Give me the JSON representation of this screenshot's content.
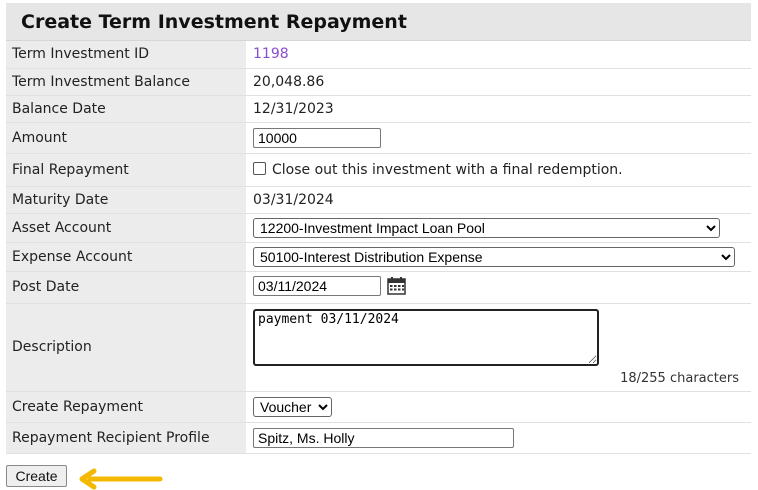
{
  "form": {
    "title": "Create Term Investment Repayment",
    "rows": {
      "term_investment_id": {
        "label": "Term Investment ID",
        "value": "1198"
      },
      "balance": {
        "label": "Term Investment Balance",
        "value": "20,048.86"
      },
      "balance_date": {
        "label": "Balance Date",
        "value": "12/31/2023"
      },
      "amount": {
        "label": "Amount",
        "value": "10000"
      },
      "final_repayment": {
        "label": "Final Repayment",
        "checkbox_label": "Close out this investment with a final redemption.",
        "checked": false
      },
      "maturity_date": {
        "label": "Maturity Date",
        "value": "03/31/2024"
      },
      "asset_account": {
        "label": "Asset Account",
        "selected": "12200-Investment Impact Loan Pool"
      },
      "expense_account": {
        "label": "Expense Account",
        "selected": "50100-Interest Distribution Expense"
      },
      "post_date": {
        "label": "Post Date",
        "value": "03/11/2024"
      },
      "description": {
        "label": "Description",
        "value": "payment 03/11/2024",
        "char_count": "18/255 characters"
      },
      "create_repayment": {
        "label": "Create Repayment",
        "selected": "Voucher"
      },
      "recipient_profile": {
        "label": "Repayment Recipient Profile",
        "value": "Spitz, Ms. Holly"
      }
    },
    "create_button": "Create"
  },
  "colors": {
    "arrow": "#f5b800",
    "link": "#8a4ccf",
    "label_bg": "#ececec",
    "header_bg": "#e6e6e6"
  }
}
